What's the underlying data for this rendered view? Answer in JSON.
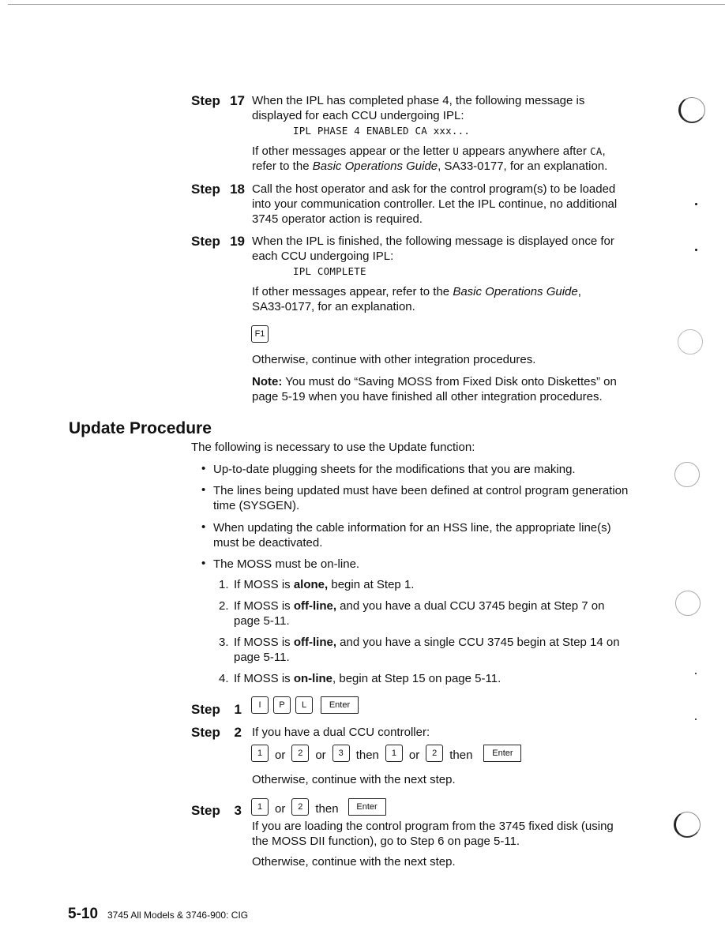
{
  "section1": {
    "steps": [
      {
        "label": "Step",
        "number": "17",
        "text": "When the IPL has completed phase 4, the following message is displayed for each CCU undergoing IPL:",
        "message": "IPL PHASE 4 ENABLED CA xxx...",
        "followup": {
          "pre": "If other messages appear or the letter ",
          "code1": "U",
          "mid": " appears anywhere after ",
          "code2": "CA",
          "post1": ",",
          "line2_pre": "refer to the ",
          "italic": "Basic Operations Guide",
          "line2_post": ", SA33-0177, for an explanation."
        }
      },
      {
        "label": "Step",
        "number": "18",
        "text": "Call the host operator and ask for the control program(s) to be loaded into your communication controller.  Let the IPL continue, no additional 3745 operator action is required."
      },
      {
        "label": "Step",
        "number": "19",
        "text": "When the IPL is finished, the following message is displayed once for each CCU undergoing IPL:",
        "message": "IPL COMPLETE",
        "followup": {
          "pre": "If other messages appear, refer to the ",
          "italic": "Basic Operations Guide",
          "post": ", SA33-0177, for an explanation."
        },
        "key": "F1",
        "otherwise": "Otherwise, continue with other integration procedures.",
        "note_label": "Note:",
        "note_text": "  You must do “Saving MOSS from Fixed Disk onto Diskettes” on page 5-19 when you have finished all other integration procedures."
      }
    ]
  },
  "update": {
    "heading": "Update Procedure",
    "intro": "The following is necessary to use the Update function:",
    "bullets": [
      "Up-to-date plugging sheets for the modifications that you are making.",
      "The lines being updated must have been defined at control program generation time (SYSGEN).",
      "When updating the cable information for an HSS line, the appropriate line(s) must be deactivated.",
      "The MOSS must be on-line."
    ],
    "numbered": [
      {
        "num": "1.",
        "pre": "If MOSS is ",
        "bold": "alone,",
        "post": " begin at Step 1."
      },
      {
        "num": "2.",
        "pre": "If MOSS is ",
        "bold": "off-line,",
        "post": " and you have a dual CCU 3745 begin at Step 7 on page 5-11."
      },
      {
        "num": "3.",
        "pre": "If MOSS is ",
        "bold": "off-line,",
        "post": " and you have a single CCU 3745 begin at Step 14 on page 5-11."
      },
      {
        "num": "4.",
        "pre": "If MOSS is ",
        "bold": "on-line",
        "post": ", begin at Step 15 on page 5-11."
      }
    ],
    "steps": [
      {
        "label": "Step",
        "number": "1",
        "keys": [
          "I",
          "P",
          "L",
          "Enter"
        ]
      },
      {
        "label": "Step",
        "number": "2",
        "text": "If you have a dual CCU controller:",
        "keys": [
          "1",
          "or",
          "2",
          "or",
          "3",
          "then",
          "1",
          "or",
          "2",
          "then",
          "Enter"
        ],
        "otherwise": "Otherwise, continue with the next step."
      },
      {
        "label": "Step",
        "number": "3",
        "keys": [
          "1",
          "or",
          "2",
          "then",
          "Enter"
        ],
        "text": "If you are loading the control program from the 3745 fixed disk (using the MOSS DII function), go to Step 6 on page 5-11.",
        "otherwise": "Otherwise, continue with the next step."
      }
    ]
  },
  "footer": {
    "page_number": "5-10",
    "title": "3745 All Models & 3746-900: CIG"
  }
}
